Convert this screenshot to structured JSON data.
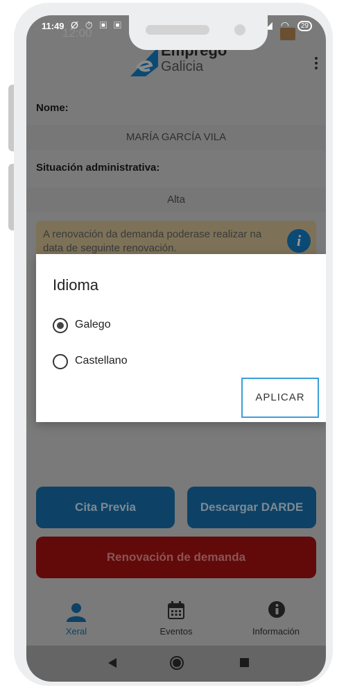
{
  "status": {
    "time": "11:49",
    "icons_left": "Ø ⏱ ▣ ▣",
    "ghost_time": "12:00",
    "battery": "29"
  },
  "app": {
    "logo_line1": "Emprego",
    "logo_line2": "Galicia"
  },
  "form": {
    "name_label": "Nome:",
    "name_value": "MARÍA GARCÍA VILA",
    "status_label": "Situación administrativa:",
    "status_value": "Alta",
    "notice": "A renovación da demanda poderase realizar na data de seguinte renovación."
  },
  "buttons": {
    "cita": "Cita Previa",
    "darde": "Descargar DARDE",
    "renovacion": "Renovación de demanda"
  },
  "bottom_nav": [
    {
      "label": "Xeral",
      "icon": "person-icon",
      "active": true
    },
    {
      "label": "Eventos",
      "icon": "calendar-icon",
      "active": false
    },
    {
      "label": "Información",
      "icon": "info-icon",
      "active": false
    }
  ],
  "dialog": {
    "title": "Idioma",
    "options": [
      {
        "label": "Galego",
        "selected": true
      },
      {
        "label": "Castellano",
        "selected": false
      }
    ],
    "apply": "APLICAR"
  },
  "colors": {
    "accent": "#3b9ed8",
    "primary": "#0d4266",
    "danger": "#620a0a",
    "overlay": "#7a7a7a"
  }
}
